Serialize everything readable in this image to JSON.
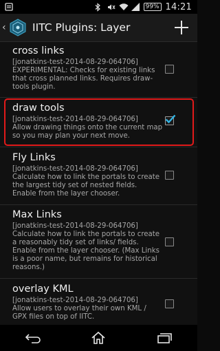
{
  "status_bar": {
    "time": "14:21",
    "battery": "99%",
    "icons": [
      "notification-icon",
      "bluetooth-icon",
      "mute-icon",
      "wifi-icon",
      "signal-icon",
      "battery-icon"
    ]
  },
  "action_bar": {
    "title": "IITC Plugins: Layer",
    "up_icon": "chevron-left-icon",
    "app_icon": "iitc-app-icon",
    "add_icon": "plus-icon"
  },
  "plugins": [
    {
      "title": "cross links",
      "id": "[jonatkins-test-2014-08-29-064706]",
      "description": "EXPERIMENTAL: Checks for existing links that cross planned links. Requires draw-tools plugin.",
      "checked": false
    },
    {
      "title": "draw tools",
      "id": "[jonatkins-test-2014-08-29-064706]",
      "description": "Allow drawing things onto the current map so you may plan your next move.",
      "checked": true
    },
    {
      "title": "Fly Links",
      "id": "[jonatkins-test-2014-08-29-064706]",
      "description": "Calculate how to link the portals to create the largest tidy set of nested fields. Enable from the layer chooser.",
      "checked": false
    },
    {
      "title": "Max Links",
      "id": "[jonatkins-test-2014-08-29-064706]",
      "description": "Calculate how to link the portals to create a reasonably tidy set of links/ fields. Enable from the layer chooser. (Max Links is a poor name, but remains for historical reasons.)",
      "checked": false
    },
    {
      "title": "overlay KML",
      "id": "[jonatkins-test-2014-08-29-064706]",
      "description": "Allow users to overlay their own KML / GPX files on top of IITC.",
      "checked": false
    }
  ],
  "nav_bar": {
    "icons": [
      "back-icon",
      "home-icon",
      "recent-apps-icon"
    ]
  },
  "colors": {
    "highlight": "#e21a1a",
    "check_accent": "#33b5e5"
  }
}
